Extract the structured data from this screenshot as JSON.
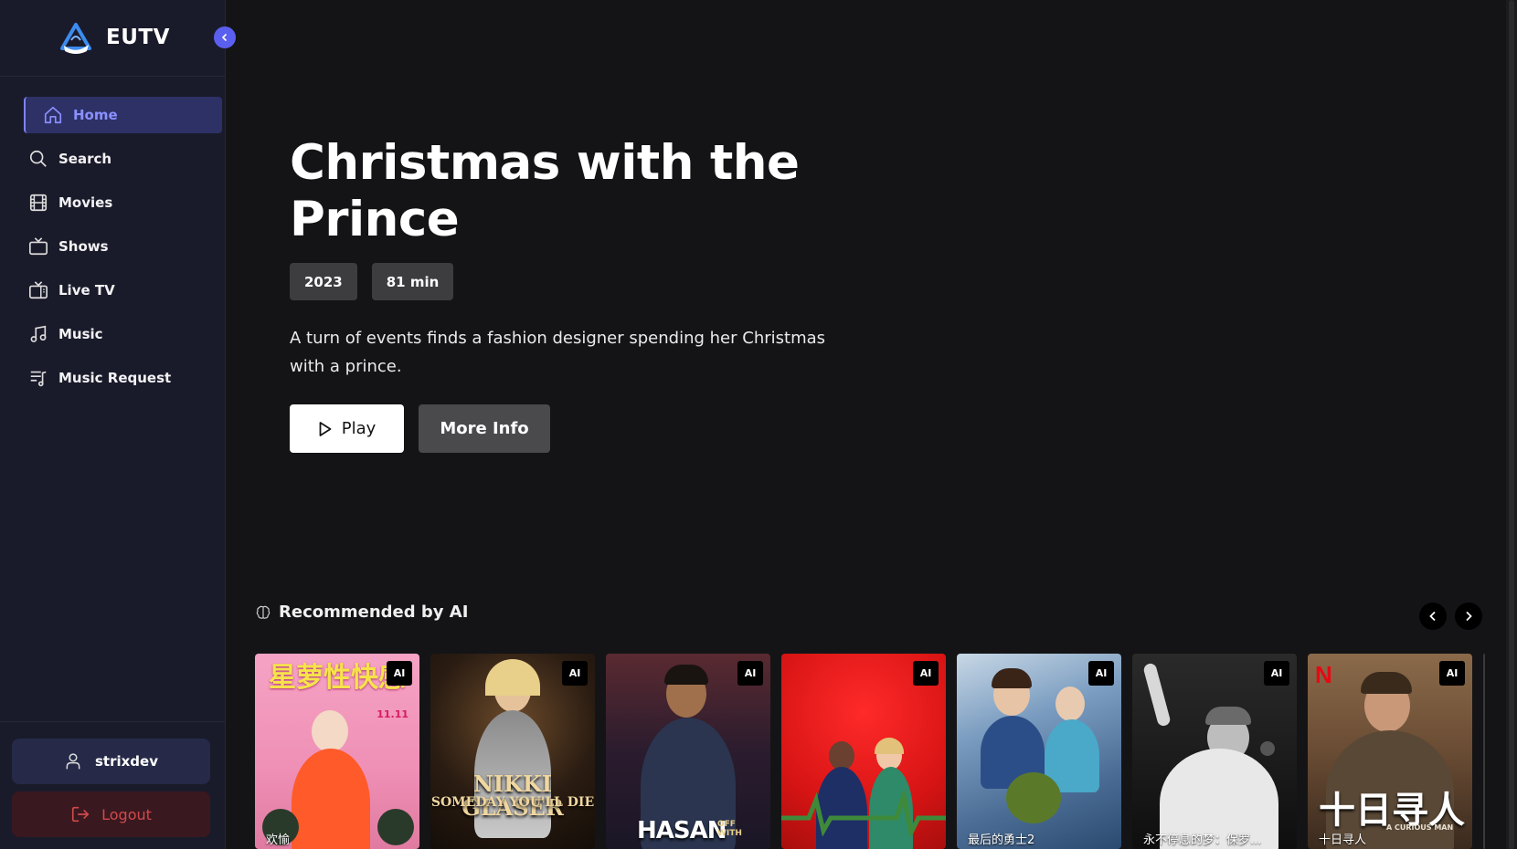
{
  "app": {
    "name": "EUTV"
  },
  "nav": {
    "items": [
      {
        "label": "Home",
        "icon": "home-icon",
        "active": true
      },
      {
        "label": "Search",
        "icon": "search-icon"
      },
      {
        "label": "Movies",
        "icon": "film-icon"
      },
      {
        "label": "Shows",
        "icon": "tv-icon"
      },
      {
        "label": "Live TV",
        "icon": "live-tv-icon"
      },
      {
        "label": "Music",
        "icon": "music-note-icon"
      },
      {
        "label": "Music Request",
        "icon": "playlist-icon"
      }
    ]
  },
  "user": {
    "name": "strixdev",
    "logout_label": "Logout"
  },
  "hero": {
    "title": "Christmas with the Prince",
    "year": "2023",
    "runtime": "81 min",
    "description": "A turn of events finds a fashion designer spending her Christmas with a prince.",
    "play_label": "Play",
    "info_label": "More Info"
  },
  "recommended": {
    "heading": "Recommended by AI",
    "badge": "AI",
    "cards": [
      {
        "caption": "欢愉",
        "poster_text": "星萝性快感",
        "poster_small": "11.11"
      },
      {
        "caption": "",
        "poster_text": "NIKKI GLASER",
        "poster_small": "SOMEDAY YOU'LL DIE"
      },
      {
        "caption": "",
        "poster_text": "HASAN",
        "poster_small": "OFF WITH"
      },
      {
        "caption": "",
        "poster_text": "",
        "poster_small": ""
      },
      {
        "caption": "最后的勇士2",
        "poster_text": "",
        "poster_small": ""
      },
      {
        "caption": "永不停息的梦：保罗...",
        "poster_text": "",
        "poster_small": ""
      },
      {
        "caption": "十日寻人",
        "poster_text": "十日寻人",
        "poster_small": "A CURIOUS MAN",
        "brand": "N"
      }
    ]
  },
  "colors": {
    "accent": "#5b5ff0",
    "active_nav_bg": "#2d3166",
    "sidebar_bg": "#1a1b2a",
    "page_bg": "#141416",
    "logout_text": "#d04a4a"
  }
}
